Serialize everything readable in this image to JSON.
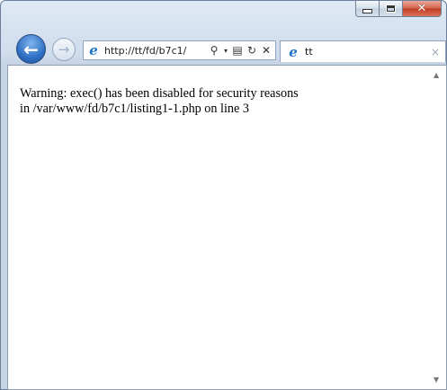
{
  "window": {
    "caption_buttons": {
      "minimize": "minimize",
      "maximize": "maximize",
      "close": "✕"
    }
  },
  "nav": {
    "back_glyph": "←",
    "forward_glyph": "→",
    "address": "http://tt/fd/b7c1/",
    "address_tools": {
      "search": "⚲",
      "dropdown": "▾",
      "compat": "▤",
      "refresh": "↻",
      "stop": "✕"
    }
  },
  "tab": {
    "title": "tt",
    "close": "×"
  },
  "page": {
    "line1": "Warning: exec() has been disabled for security reasons",
    "line2": "in /var/www/fd/b7c1/listing1-1.php on line 3"
  },
  "scrollbar": {
    "up": "▲",
    "down": "▼"
  },
  "colors": {
    "accent": "#2f6fc4",
    "close": "#c13b22",
    "chrome": "#cfdcec"
  }
}
